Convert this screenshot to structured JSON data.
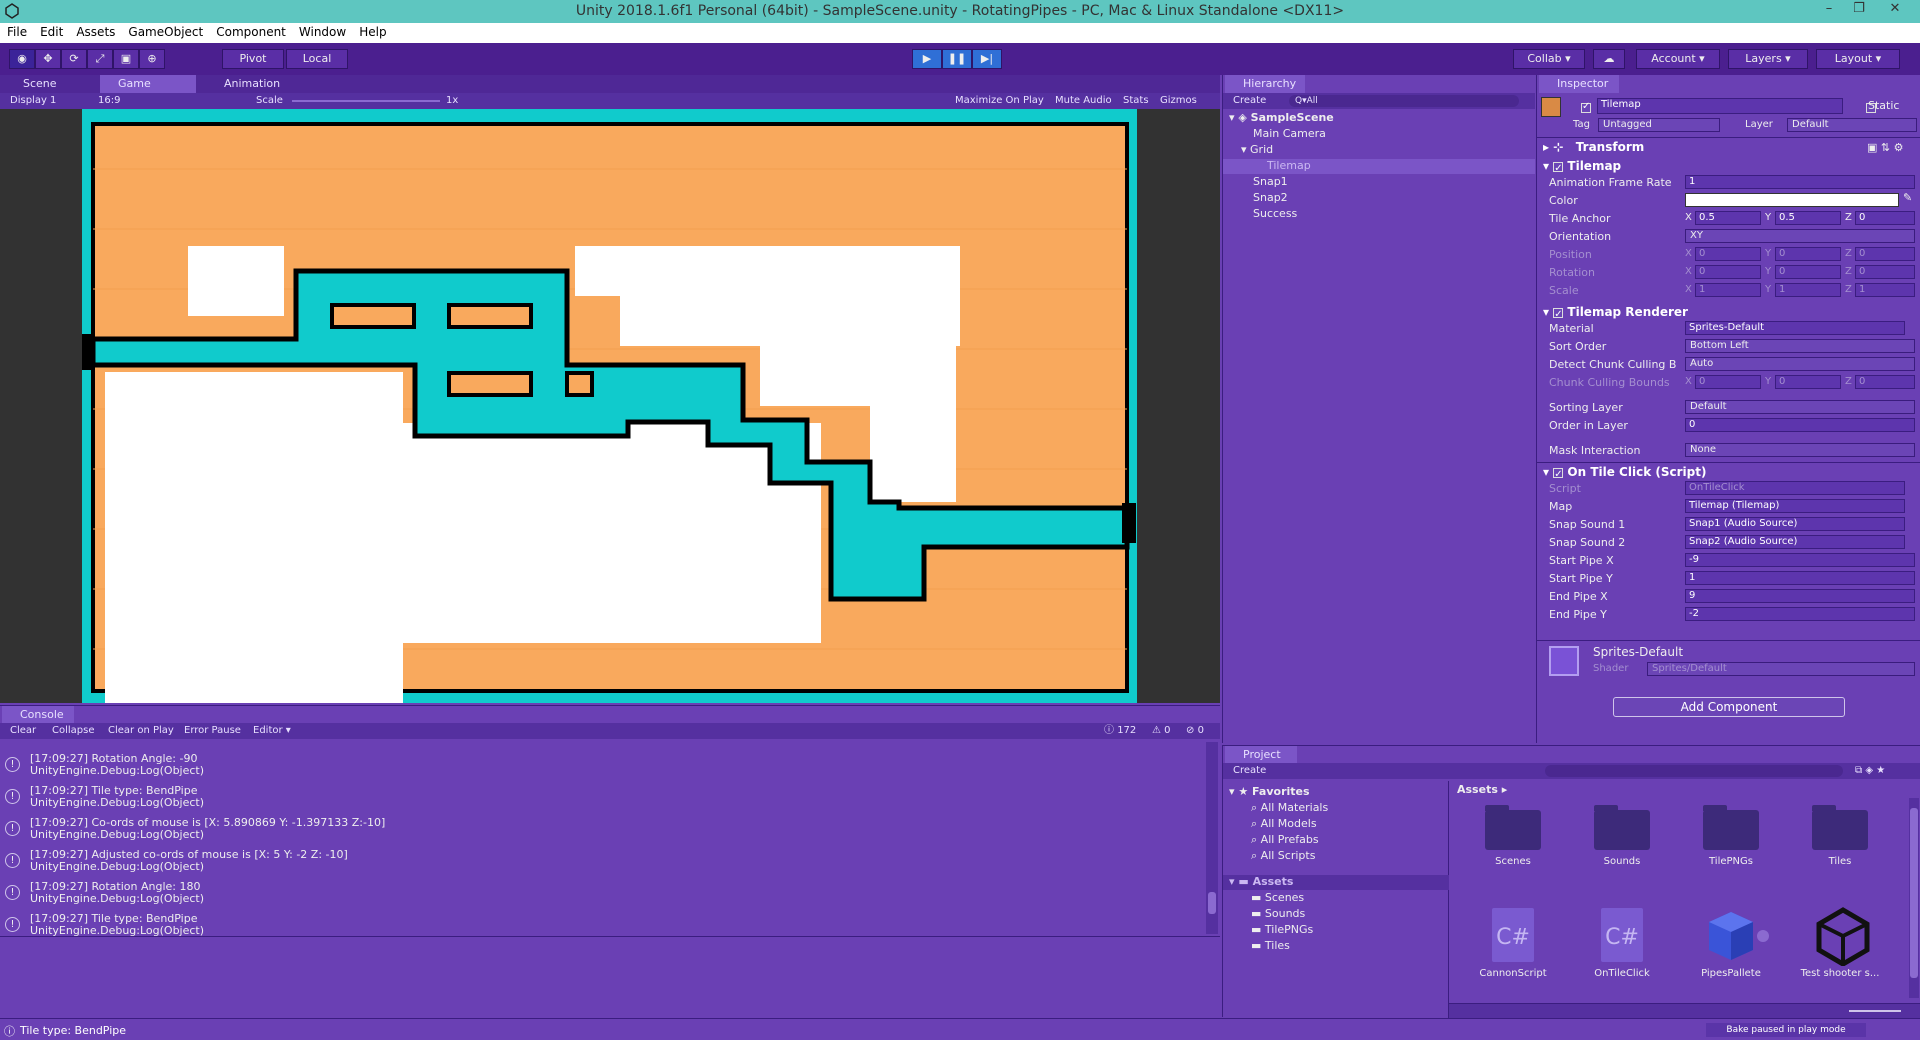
{
  "titlebar": {
    "title": "Unity 2018.1.6f1 Personal (64bit) - SampleScene.unity - RotatingPipes - PC, Mac & Linux Standalone <DX11>",
    "minimize": "–",
    "maximize": "❐",
    "close": "✕"
  },
  "menu": [
    "File",
    "Edit",
    "Assets",
    "GameObject",
    "Component",
    "Window",
    "Help"
  ],
  "toolbar": {
    "pivot": "Pivot",
    "local": "Local",
    "collab": "Collab",
    "account": "Account",
    "layers": "Layers",
    "layout": "Layout"
  },
  "scene_tabs": {
    "scene": "Scene",
    "game": "Game",
    "animation": "Animation"
  },
  "game_bar": {
    "display": "Display 1",
    "aspect": "16:9",
    "scale_label": "Scale",
    "scale_value": "1x",
    "maximize": "Maximize On Play",
    "mute": "Mute Audio",
    "stats": "Stats",
    "gizmos": "Gizmos"
  },
  "hierarchy": {
    "tab": "Hierarchy",
    "create": "Create",
    "search_placeholder": "Q▾All",
    "scene": "SampleScene",
    "items": [
      "Main Camera",
      "Grid",
      "Tilemap",
      "Snap1",
      "Snap2",
      "Success"
    ]
  },
  "inspector": {
    "tab": "Inspector",
    "object_name": "Tilemap",
    "static": "Static",
    "tag_label": "Tag",
    "tag": "Untagged",
    "layer_label": "Layer",
    "layer": "Default",
    "transform": {
      "title": "Transform"
    },
    "tilemap": {
      "title": "Tilemap",
      "frame_rate_label": "Animation Frame Rate",
      "frame_rate": "1",
      "color_label": "Color",
      "anchor_label": "Tile Anchor",
      "anchor_x": "0.5",
      "anchor_y": "0.5",
      "anchor_z": "0",
      "orientation_label": "Orientation",
      "orientation": "XY",
      "position_label": "Position",
      "pos_x": "0",
      "pos_y": "0",
      "pos_z": "0",
      "rotation_label": "Rotation",
      "rot_x": "0",
      "rot_y": "0",
      "rot_z": "0",
      "scale_label": "Scale",
      "sc_x": "1",
      "sc_y": "1",
      "sc_z": "1"
    },
    "renderer": {
      "title": "Tilemap Renderer",
      "material_label": "Material",
      "material": "Sprites-Default",
      "sort_label": "Sort Order",
      "sort": "Bottom Left",
      "detect_label": "Detect Chunk Culling B",
      "detect": "Auto",
      "chunk_label": "Chunk Culling Bounds",
      "cx": "0",
      "cy": "0",
      "cz": "0",
      "sorting_layer_label": "Sorting Layer",
      "sorting_layer": "Default",
      "order_label": "Order in Layer",
      "order": "0",
      "mask_label": "Mask Interaction",
      "mask": "None"
    },
    "script": {
      "title": "On Tile Click (Script)",
      "script_label": "Script",
      "script": "OnTileClick",
      "map_label": "Map",
      "map": "Tilemap (Tilemap)",
      "snap1_label": "Snap Sound 1",
      "snap1": "Snap1 (Audio Source)",
      "snap2_label": "Snap Sound 2",
      "snap2": "Snap2 (Audio Source)",
      "spx_label": "Start Pipe X",
      "spx": "-9",
      "spy_label": "Start Pipe Y",
      "spy": "1",
      "epx_label": "End Pipe X",
      "epx": "9",
      "epy_label": "End Pipe Y",
      "epy": "-2"
    },
    "material": {
      "name": "Sprites-Default",
      "shader_label": "Shader",
      "shader": "Sprites/Default"
    },
    "add_component": "Add Component"
  },
  "console": {
    "tab": "Console",
    "clear": "Clear",
    "collapse": "Collapse",
    "clear_on_play": "Clear on Play",
    "error_pause": "Error Pause",
    "editor": "Editor",
    "count_log": "172",
    "count_warn": "0",
    "count_err": "0",
    "entries": [
      {
        "line1": "[17:09:27] Rotation Angle: -90",
        "line2": "UnityEngine.Debug:Log(Object)"
      },
      {
        "line1": "[17:09:27] Tile type: BendPipe",
        "line2": "UnityEngine.Debug:Log(Object)"
      },
      {
        "line1": "[17:09:27] Co-ords of mouse is [X: 5.890869 Y: -1.397133 Z:-10]",
        "line2": "UnityEngine.Debug:Log(Object)"
      },
      {
        "line1": "[17:09:27] Adjusted co-ords of mouse is [X: 5 Y: -2 Z: -10]",
        "line2": "UnityEngine.Debug:Log(Object)"
      },
      {
        "line1": "[17:09:27] Rotation Angle: 180",
        "line2": "UnityEngine.Debug:Log(Object)"
      },
      {
        "line1": "[17:09:27] Tile type: BendPipe",
        "line2": "UnityEngine.Debug:Log(Object)"
      }
    ]
  },
  "project": {
    "tab": "Project",
    "create": "Create",
    "favorites": "Favorites",
    "fav_items": [
      "All Materials",
      "All Models",
      "All Prefabs",
      "All Scripts"
    ],
    "assets": "Assets",
    "asset_folders": [
      "Scenes",
      "Sounds",
      "TilePNGs",
      "Tiles"
    ],
    "breadcrumb": "Assets ▸",
    "grid": [
      "Scenes",
      "Sounds",
      "TilePNGs",
      "Tiles",
      "CannonScript",
      "OnTileClick",
      "PipesPallete",
      "Test shooter s..."
    ]
  },
  "status": {
    "message": "Tile type: BendPipe",
    "bake": "Bake paused in play mode"
  },
  "colors": {
    "accent_teal": "#10cbcc",
    "sand": "#f9a95d",
    "purple": "#6a40b4"
  }
}
